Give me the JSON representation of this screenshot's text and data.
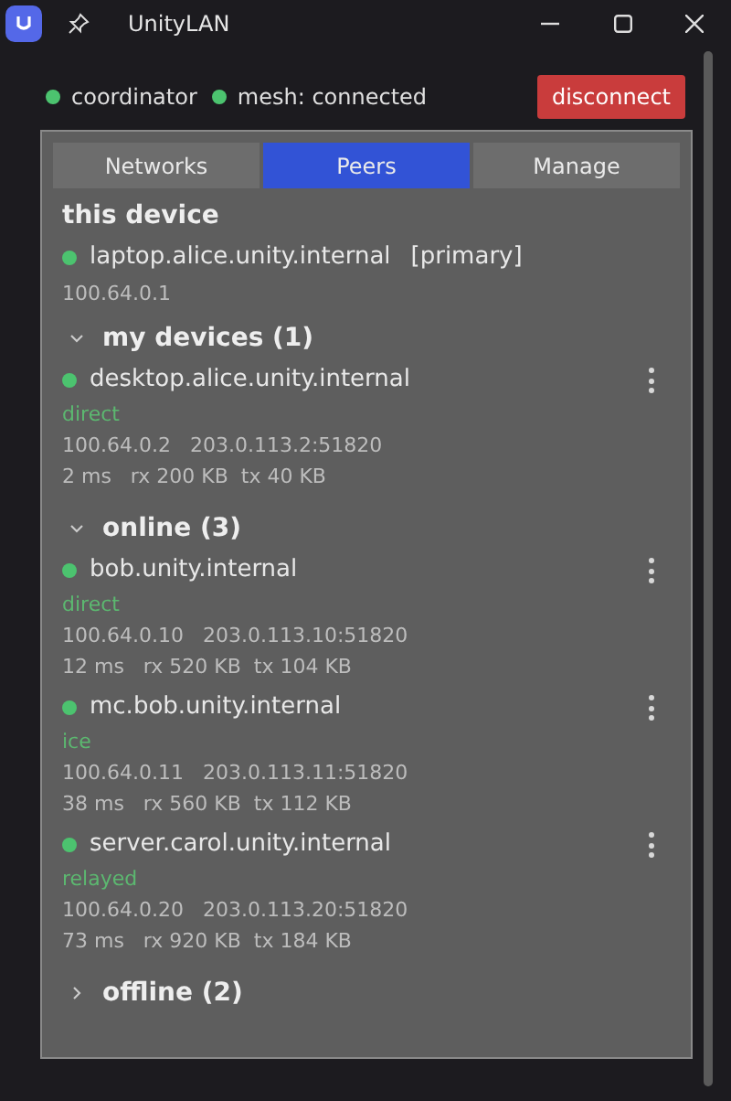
{
  "window": {
    "title": "UnityLAN"
  },
  "status": [
    {
      "label": "coordinator",
      "color": "#4cc36f"
    },
    {
      "label": "mesh: connected",
      "color": "#4cc36f"
    }
  ],
  "disconnect_button": "disconnect",
  "tabs": [
    {
      "label": "Networks",
      "selected": false
    },
    {
      "label": "Peers",
      "selected": true
    },
    {
      "label": "Manage",
      "selected": false
    }
  ],
  "this_device": {
    "heading": "this device",
    "name": "laptop.alice.unity.internal",
    "tag": "[primary]",
    "address": "100.64.0.1",
    "color": "#4cc36f"
  },
  "groups": [
    {
      "title": "my devices (1)",
      "expanded": true,
      "peers": [
        {
          "name": "desktop.alice.unity.internal",
          "color": "#4cc36f",
          "path": "direct",
          "addresses": "100.64.0.2   203.0.113.2:51820",
          "stats": "2 ms   rx 200 KB  tx 40 KB"
        }
      ]
    },
    {
      "title": "online (3)",
      "expanded": true,
      "peers": [
        {
          "name": "bob.unity.internal",
          "color": "#4cc36f",
          "path": "direct",
          "addresses": "100.64.0.10   203.0.113.10:51820",
          "stats": "12 ms   rx 520 KB  tx 104 KB"
        },
        {
          "name": "mc.bob.unity.internal",
          "color": "#4cc36f",
          "path": "ice",
          "addresses": "100.64.0.11   203.0.113.11:51820",
          "stats": "38 ms   rx 560 KB  tx 112 KB"
        },
        {
          "name": "server.carol.unity.internal",
          "color": "#4cc36f",
          "path": "relayed",
          "addresses": "100.64.0.20   203.0.113.20:51820",
          "stats": "73 ms   rx 920 KB  tx 184 KB"
        }
      ]
    },
    {
      "title": "offline (2)",
      "expanded": false
    }
  ]
}
